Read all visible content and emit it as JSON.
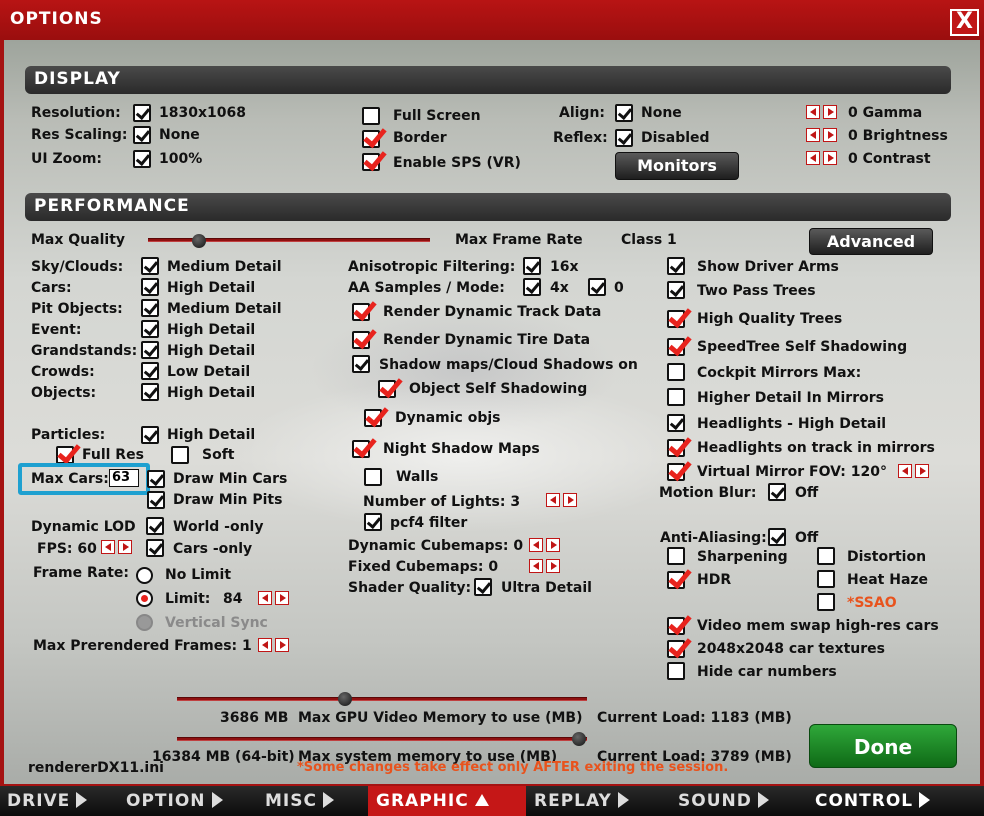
{
  "window": {
    "title": "OPTIONS",
    "close": "X"
  },
  "display": {
    "header": "DISPLAY",
    "resolution_label": "Resolution:",
    "resolution_value": "1830x1068",
    "res_scaling_label": "Res Scaling:",
    "res_scaling_value": "None",
    "ui_zoom_label": "UI Zoom:",
    "ui_zoom_value": "100%",
    "full_screen": "Full Screen",
    "border": "Border",
    "enable_sps": "Enable SPS (VR)",
    "align_label": "Align:",
    "align_value": "None",
    "reflex_label": "Reflex:",
    "reflex_value": "Disabled",
    "monitors_button": "Monitors",
    "gamma": "0 Gamma",
    "brightness": "0 Brightness",
    "contrast": "0 Contrast"
  },
  "performance": {
    "header": "PERFORMANCE",
    "max_quality": "Max Quality",
    "max_frame_rate": "Max Frame Rate",
    "class": "Class 1",
    "advanced_button": "Advanced",
    "rows": [
      {
        "label": "Sky/Clouds:",
        "value": "Medium Detail"
      },
      {
        "label": "Cars:",
        "value": "High Detail"
      },
      {
        "label": "Pit Objects:",
        "value": "Medium Detail"
      },
      {
        "label": "Event:",
        "value": "High Detail"
      },
      {
        "label": "Grandstands:",
        "value": "High Detail"
      },
      {
        "label": "Crowds:",
        "value": "Low Detail"
      },
      {
        "label": "Objects:",
        "value": "High Detail"
      }
    ],
    "particles_label": "Particles:",
    "particles_value": "High Detail",
    "full_res": "Full Res",
    "soft": "Soft",
    "max_cars_label": "Max Cars:",
    "max_cars_value": "63",
    "draw_min_cars": "Draw Min Cars",
    "draw_min_pits": "Draw Min Pits",
    "dynamic_lod": "Dynamic LOD",
    "world_only": "World -only",
    "fps_label": "FPS: 60",
    "cars_only": "Cars -only",
    "frame_rate_label": "Frame Rate:",
    "no_limit": "No Limit",
    "limit": "Limit:",
    "limit_value": "84",
    "vertical_sync": "Vertical Sync",
    "max_prerendered": "Max Prerendered Frames: 1",
    "aniso_label": "Anisotropic Filtering:",
    "aniso_value": "16x",
    "aa_label": "AA Samples / Mode:",
    "aa_samples": "4x",
    "aa_mode": "0",
    "render_track": "Render Dynamic Track Data",
    "render_tire": "Render Dynamic Tire Data",
    "shadow_maps": "Shadow maps/Cloud Shadows on",
    "object_self_shadowing": "Object Self Shadowing",
    "dynamic_objs": "Dynamic objs",
    "night_shadow": "Night Shadow Maps",
    "walls": "Walls",
    "num_lights": "Number of Lights: 3",
    "pcf4": "pcf4 filter",
    "dyn_cubemaps": "Dynamic Cubemaps: 0",
    "fixed_cubemaps": "Fixed Cubemaps: 0",
    "shader_quality_label": "Shader Quality:",
    "shader_quality_value": "Ultra Detail",
    "show_driver_arms": "Show Driver Arms",
    "two_pass_trees": "Two Pass Trees",
    "hq_trees": "High Quality Trees",
    "speedtree": "SpeedTree Self Shadowing",
    "cockpit_mirrors": "Cockpit Mirrors  Max:",
    "higher_detail_mirrors": "Higher Detail In Mirrors",
    "headlights_hd": "Headlights - High Detail",
    "headlights_track": "Headlights on track in mirrors",
    "virtual_mirror": "Virtual Mirror  FOV:  120°",
    "motion_blur_label": "Motion Blur:",
    "motion_blur_value": "Off",
    "aa_label2": "Anti-Aliasing:",
    "aa_value2": "Off",
    "sharpening": "Sharpening",
    "distortion": "Distortion",
    "hdr": "HDR",
    "heat_haze": "Heat Haze",
    "ssao": "*SSAO",
    "video_mem_swap": "Video mem swap high-res cars",
    "car_textures": "2048x2048 car textures",
    "hide_car_numbers": "Hide car numbers",
    "gpu_mem_value": "3686 MB",
    "gpu_mem_label": "Max GPU Video Memory to use (MB)",
    "gpu_load": "Current Load: 1183 (MB)",
    "sys_mem_value": "16384 MB (64-bit)",
    "sys_mem_label": "Max system memory to use (MB)",
    "sys_load": "Current Load: 3789 (MB)",
    "renderer": "rendererDX11.ini",
    "warning": "*Some changes take effect only AFTER exiting the session.",
    "done_button": "Done"
  },
  "levels": {
    "max_quality": 0.18,
    "gpu_memory": 0.41,
    "system_memory": 0.98
  },
  "bottom_nav": [
    "DRIVE",
    "OPTION",
    "MISC",
    "GRAPHIC",
    "REPLAY",
    "SOUND",
    "CONTROL"
  ],
  "colors": {
    "accent_red": "#c51717",
    "check_red": "#e8231d",
    "highlight_blue": "#1ea0d0",
    "done_green": "#1f8a28",
    "warning_orange": "#e8531d"
  }
}
